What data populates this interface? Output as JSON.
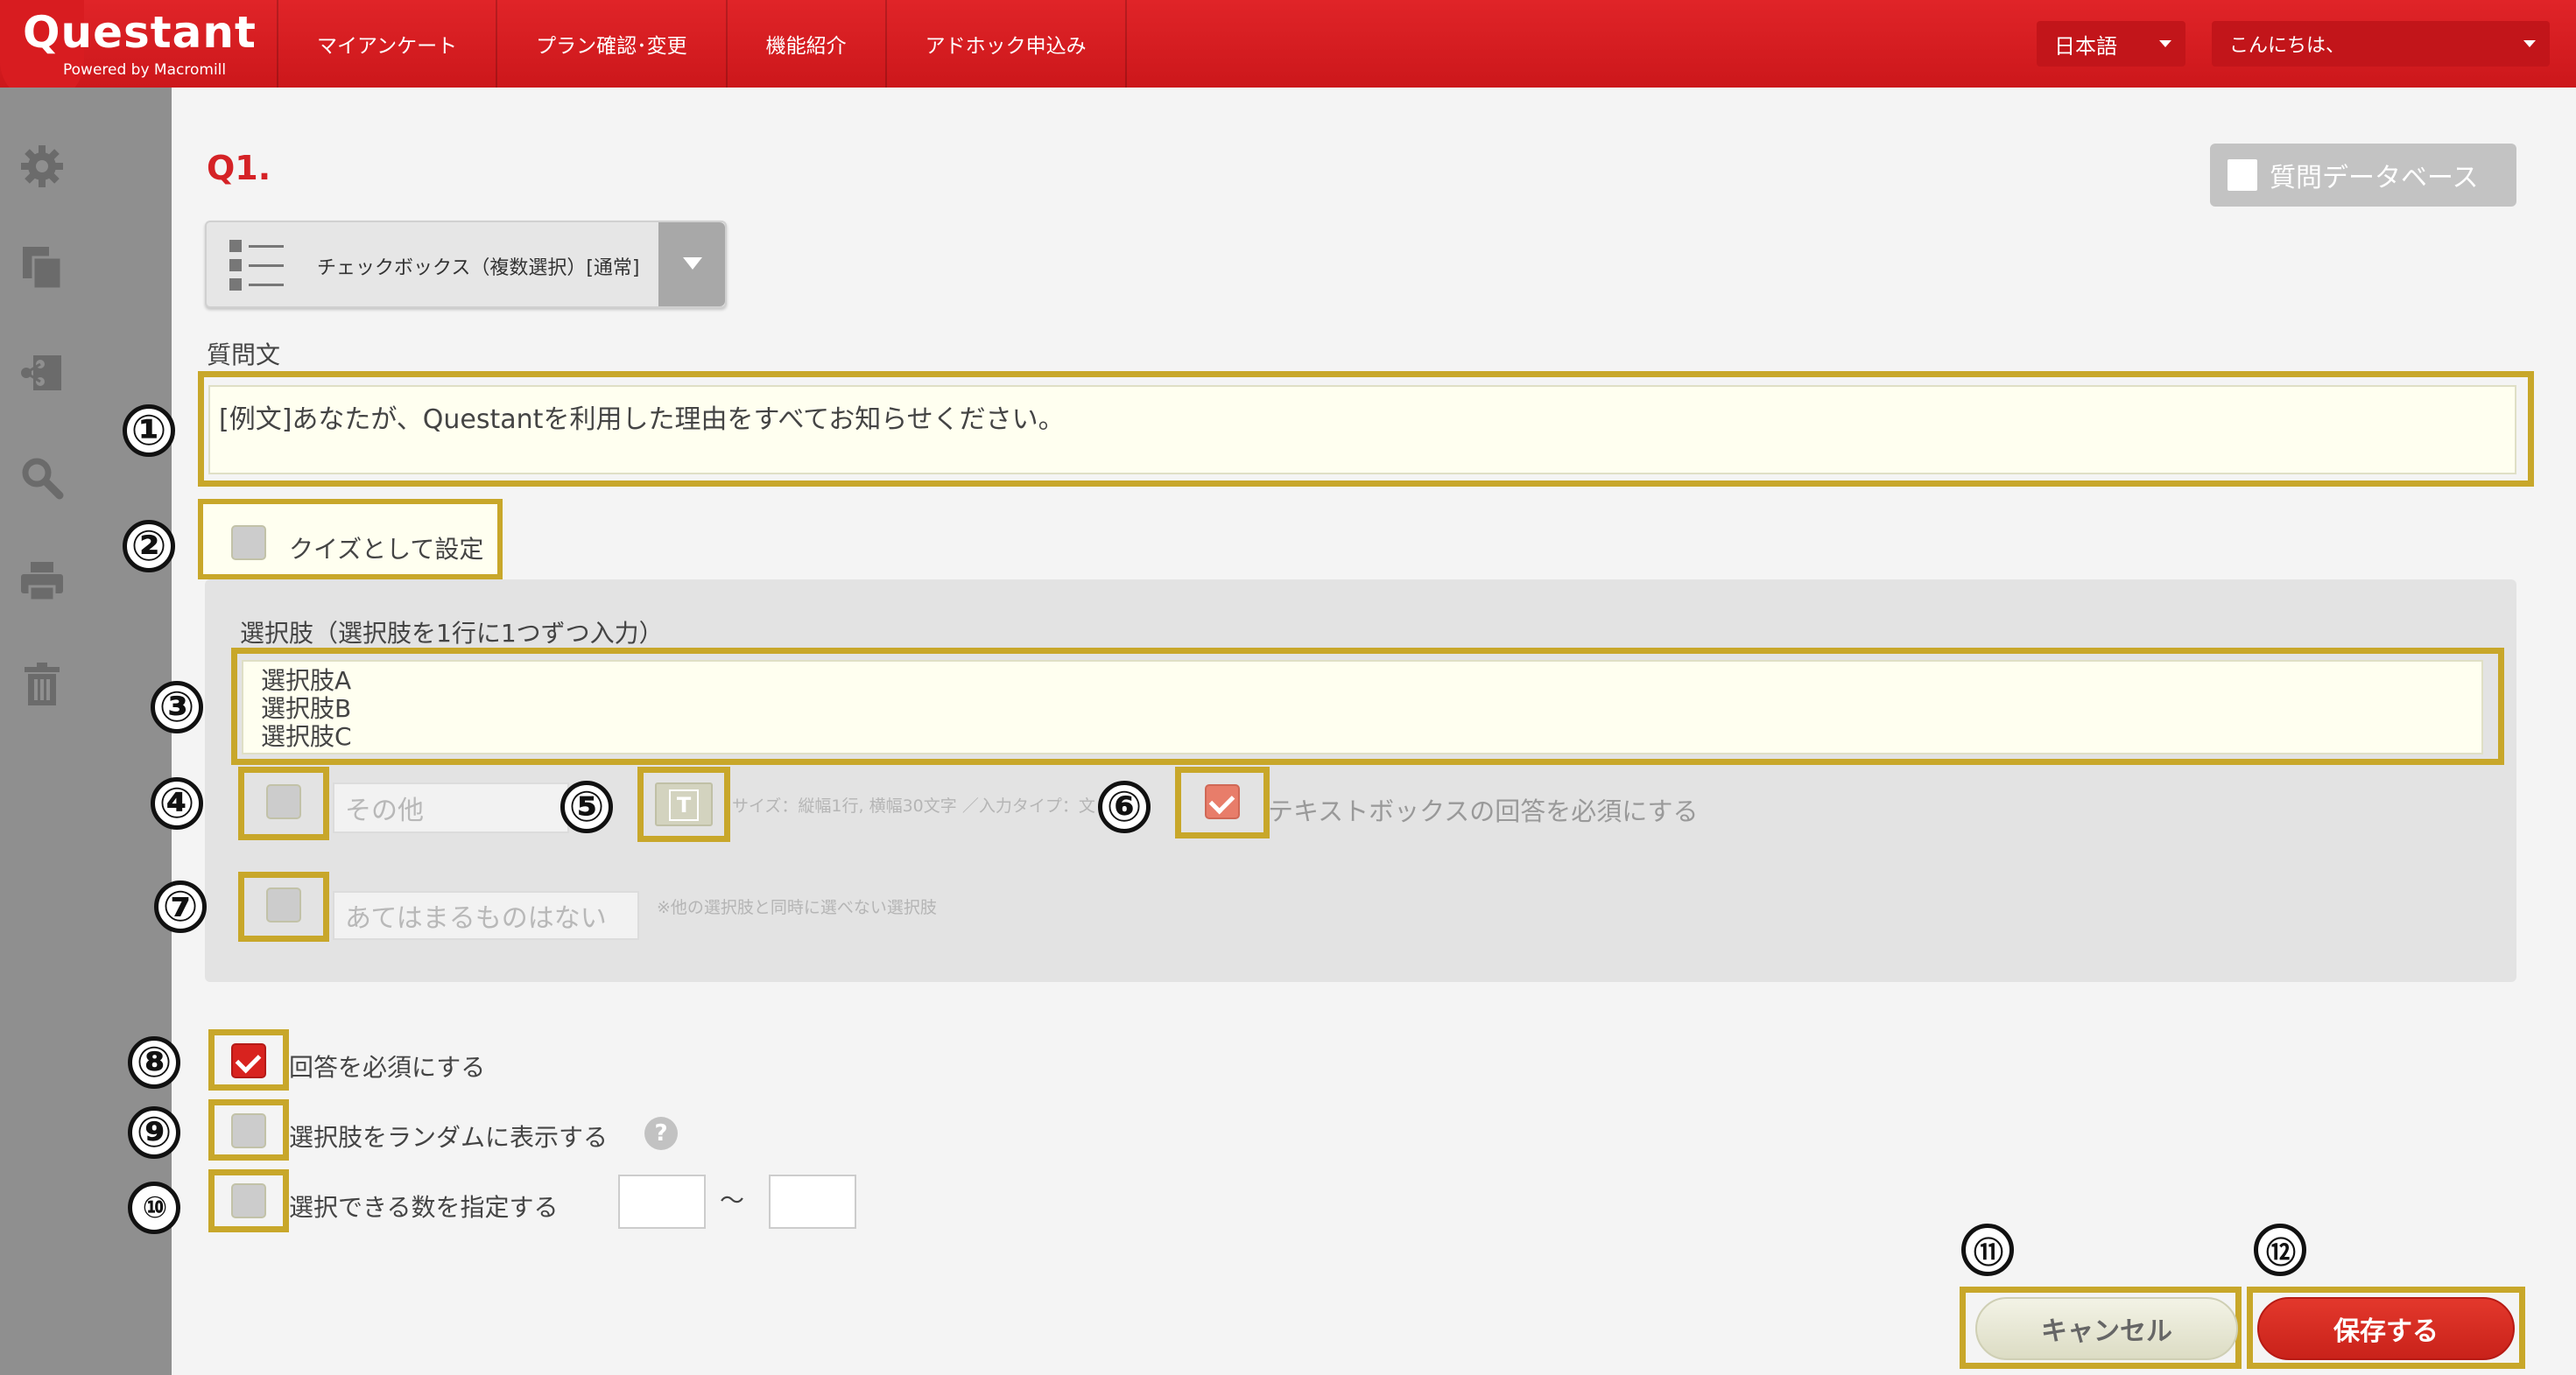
{
  "header": {
    "logo": "Questant",
    "logo_sub": "Powered by Macromill",
    "nav": [
      "マイアンケート",
      "プラン確認･変更",
      "機能紹介",
      "アドホック申込み"
    ],
    "language": "日本語",
    "greeting": "こんにちは、"
  },
  "sidebar": {
    "icons": [
      "gear-icon",
      "copy-icon",
      "share-icon",
      "search-icon",
      "print-icon",
      "trash-icon"
    ]
  },
  "question": {
    "number": "Q1.",
    "database_button": "質問データベース",
    "type_label": "チェックボックス（複数選択）[通常]",
    "question_label": "質問文",
    "question_text": "[例文]あなたが、Questantを利用した理由をすべてお知らせください。",
    "quiz_label": "クイズとして設定",
    "choices_label": "選択肢（選択肢を1行に1つずつ入力）",
    "choices": [
      "選択肢A",
      "選択肢B",
      "選択肢C"
    ],
    "other_placeholder": "その他",
    "other_hint": "サイズ：縦幅1行, 横幅30文字 ／入力タイプ：文",
    "textbox_required_label": "テキストボックスの回答を必須にする",
    "none_placeholder": "あてはまるものはない",
    "none_hint": "※他の選択肢と同時に選べない選択肢",
    "required_label": "回答を必須にする",
    "random_label": "選択肢をランダムに表示する",
    "help": "?",
    "limit_label": "選択できる数を指定する",
    "range_sep": "〜",
    "cancel_button": "キャンセル",
    "save_button": "保存する"
  },
  "annotations": [
    "①",
    "②",
    "③",
    "④",
    "⑤",
    "⑥",
    "⑦",
    "⑧",
    "⑨",
    "⑩",
    "⑪",
    "⑫"
  ],
  "colors": {
    "brand_red": "#d81c20",
    "highlight": "#c8a72a",
    "input_bg": "#fffff0"
  },
  "states": {
    "textbox_required_checked": true,
    "answer_required_checked": true
  }
}
